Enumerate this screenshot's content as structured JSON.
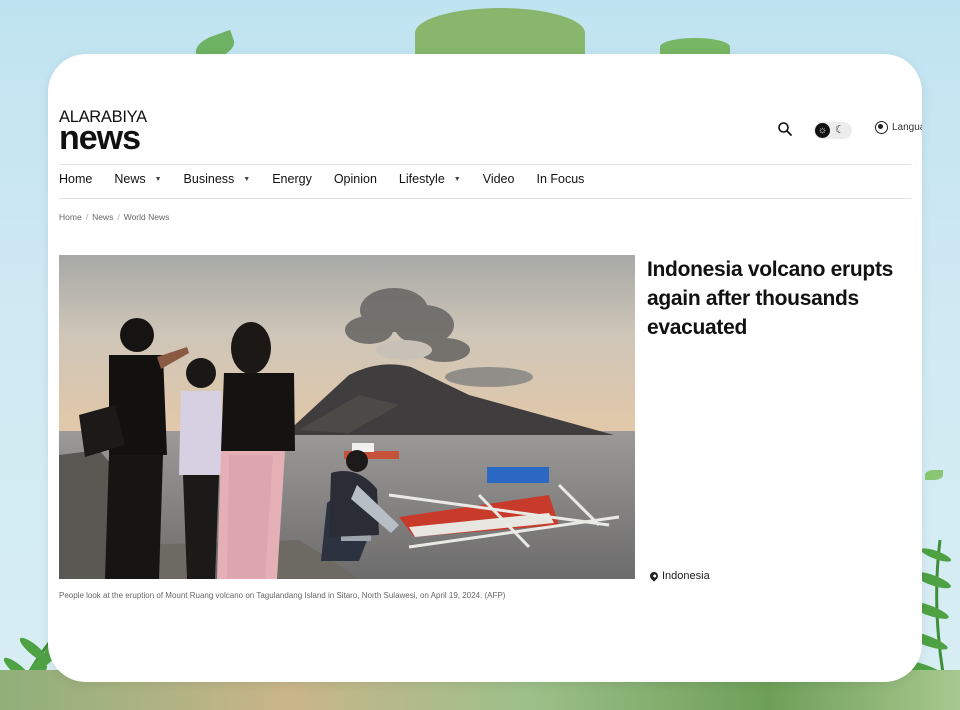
{
  "site": {
    "logo_top": "ALARABIYA",
    "logo_main": "news"
  },
  "header": {
    "language_label": "Language"
  },
  "nav": {
    "items": [
      {
        "label": "Home",
        "dropdown": false
      },
      {
        "label": "News",
        "dropdown": true
      },
      {
        "label": "Business",
        "dropdown": true
      },
      {
        "label": "Energy",
        "dropdown": false
      },
      {
        "label": "Opinion",
        "dropdown": false
      },
      {
        "label": "Lifestyle",
        "dropdown": true
      },
      {
        "label": "Video",
        "dropdown": false
      },
      {
        "label": "In Focus",
        "dropdown": false
      }
    ]
  },
  "breadcrumb": [
    "Home",
    "News",
    "World News"
  ],
  "article": {
    "headline": "Indonesia volcano erupts again after thousands evacuated",
    "tag": "Indonesia",
    "caption": "People look at the eruption of Mount Ruang volcano on Tagulandang Island in Sitaro, North Sulawesi, on April 19, 2024. (AFP)"
  },
  "icons": {
    "search": "search-icon",
    "theme_light": "sun-icon",
    "theme_dark": "moon-icon",
    "language": "globe-icon",
    "location": "location-pin-icon"
  },
  "colors": {
    "text": "#111111",
    "muted": "#666666",
    "page_bg": "#ffffff",
    "backdrop": "#cfe9f3"
  }
}
